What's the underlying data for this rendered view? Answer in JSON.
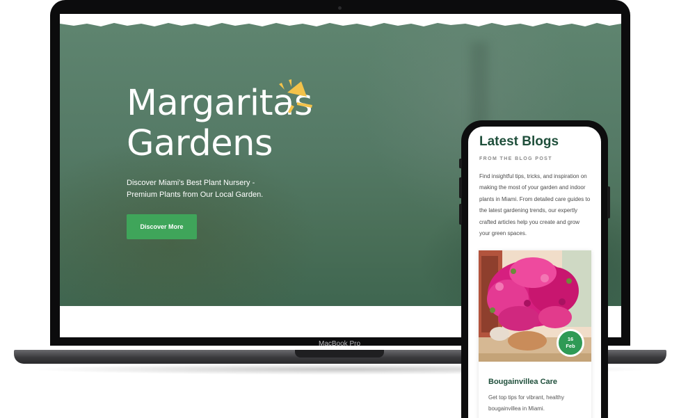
{
  "laptop": {
    "brand_label": "MacBook Pro",
    "hero": {
      "title": "Margaritas Gardens",
      "subtitle": "Discover Miami's Best Plant Nursery - Premium Plants from Our Local Garden.",
      "cta_label": "Discover More"
    }
  },
  "phone": {
    "section_title": "Latest Blogs",
    "kicker": "FROM THE BLOG POST",
    "description": "Find insightful tips, tricks, and inspiration on making the most of your garden and indoor plants in Miami. From detailed care guides to the latest gardening trends, our expertly crafted articles help you create and grow your green spaces.",
    "post": {
      "date_day": "16",
      "date_month": "Feb",
      "title": "Bougainvillea Care",
      "excerpt": "Get top tips for vibrant, healthy bougainvillea in Miami."
    }
  },
  "colors": {
    "brand_green": "#3fa55a",
    "heading_green": "#1f4f3b",
    "sparkle_yellow": "#f3c24a"
  },
  "icons": [
    "sparkle-icon",
    "flower-photo"
  ]
}
